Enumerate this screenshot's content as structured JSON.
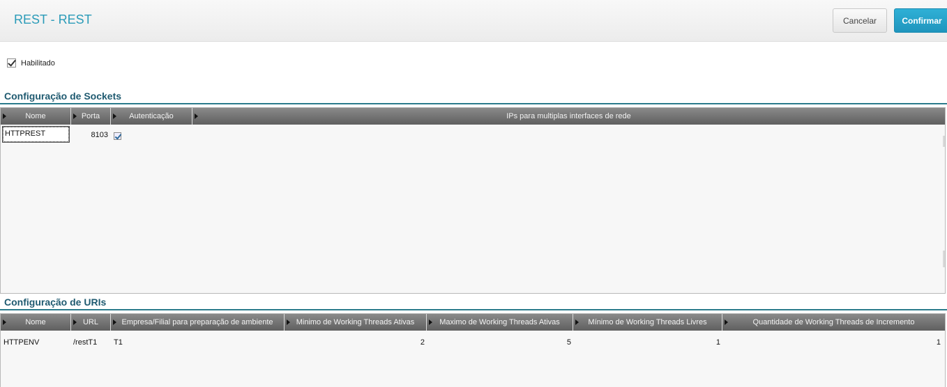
{
  "header": {
    "title": "REST - REST",
    "cancel_label": "Cancelar",
    "confirm_label": "Confirmar"
  },
  "enabled": {
    "label": "Habilitado",
    "checked": true
  },
  "sockets": {
    "title": "Configuração de Sockets",
    "columns": [
      "Nome",
      "Porta",
      "Autenticação",
      "IPs para multiplas interfaces de rede"
    ],
    "rows": [
      {
        "nome": "HTTPREST",
        "porta": "8103",
        "autenticacao": true,
        "ips": ""
      }
    ]
  },
  "uris": {
    "title": "Configuração de URIs",
    "columns": [
      "Nome",
      "URL",
      "Empresa/Filial para preparação de ambiente",
      "Minimo de Working Threads Ativas",
      "Maximo de Working Threads Ativas",
      "Mínimo de Working Threads Livres",
      "Quantidade de Working Threads de Incremento"
    ],
    "rows": [
      {
        "nome": "HTTPENV",
        "url": "/restT1",
        "empresa": "T1",
        "min_ativas": "2",
        "max_ativas": "5",
        "min_livres": "1",
        "incremento": "1"
      }
    ]
  },
  "colors": {
    "accent": "#2a9bb8",
    "confirm": "#1f95bd",
    "section": "#1f5a70"
  }
}
